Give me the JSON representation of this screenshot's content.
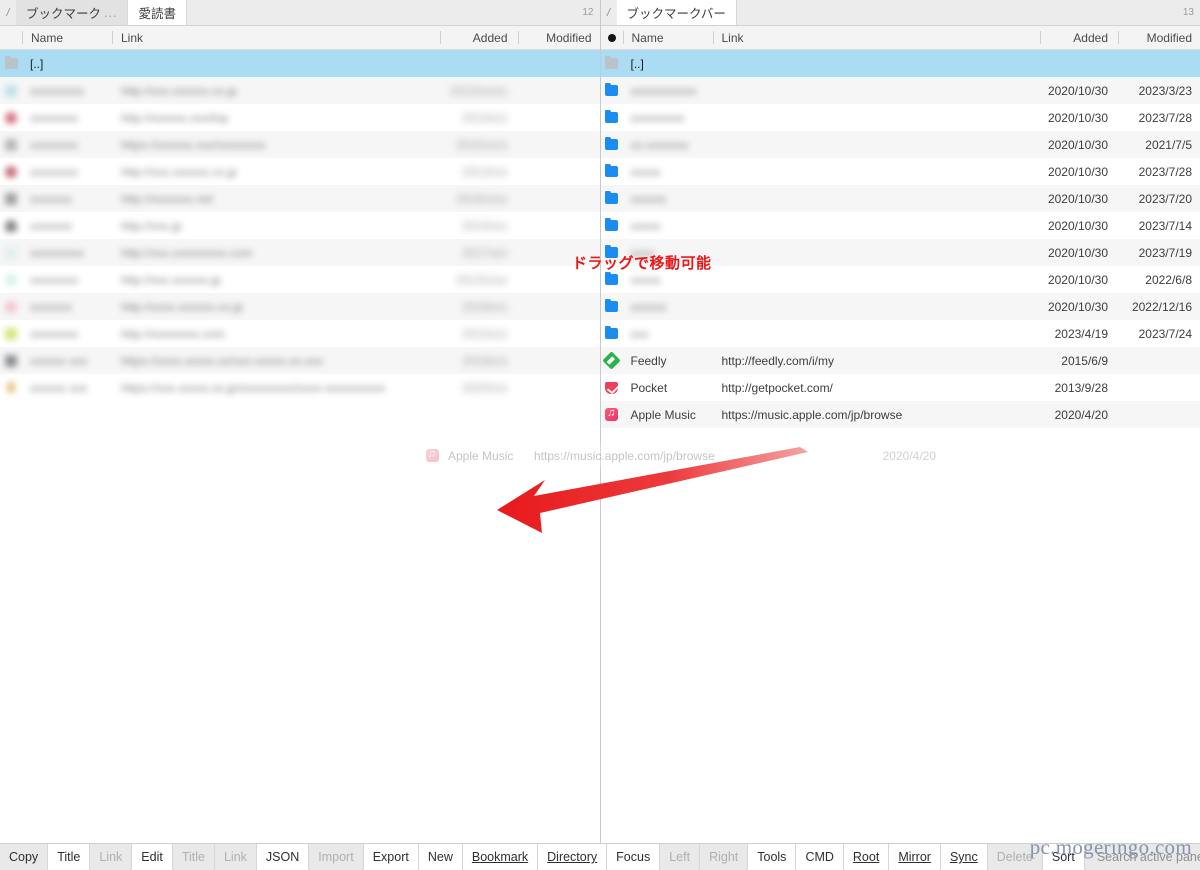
{
  "left_pane": {
    "tab_prefix": "/",
    "tabs": [
      {
        "label": "ブックマーク",
        "ellipsis": "...",
        "active": false
      },
      {
        "label": "愛読書",
        "ellipsis": "",
        "active": true
      }
    ],
    "count": "12",
    "columns": {
      "name": "Name",
      "link": "Link",
      "added": "Added",
      "modified": "Modified"
    },
    "rows": [
      {
        "icon": "folder-up-icon",
        "name": "[..]",
        "link": "",
        "added": "",
        "modified": "",
        "selected": true,
        "masked": false
      },
      {
        "icon": "favicon",
        "color": "#9fd4e0",
        "name": "xxxxxxxxx",
        "link": "http://xxx.xxxxxx.co.jp",
        "added": "2013/xx/xx",
        "modified": "",
        "masked": true
      },
      {
        "icon": "favicon",
        "color": "#bb2233",
        "name": "xxxxxxxx",
        "link": "http://xxxxxx.xxx/top",
        "added": "2014/x/x",
        "modified": "",
        "masked": true
      },
      {
        "icon": "favicon",
        "color": "#8b9096",
        "name": "xxxxxxxx",
        "link": "https://xxxxxx.xxx/xxxxxxxx",
        "added": "2015/xx/x",
        "modified": "",
        "masked": true
      },
      {
        "icon": "favicon",
        "color": "#a31a2a",
        "name": "xxxxxxxx",
        "link": "http://xxx.xxxxxx.co.jp",
        "added": "2013/x/x",
        "modified": "",
        "masked": true
      },
      {
        "icon": "favicon",
        "color": "#6c6c6c",
        "name": "xxxxxxx",
        "link": "http://xxxxxxx.net",
        "added": "2016/x/xx",
        "modified": "",
        "masked": true
      },
      {
        "icon": "favicon",
        "color": "#3f3f3f",
        "name": "xxxxxxx",
        "link": "http://xxx.jp",
        "added": "2014/x/x",
        "modified": "",
        "masked": true
      },
      {
        "icon": "favicon",
        "color": "#cfece9",
        "name": "xxxxxxxxx",
        "link": "http://xxx.xxxxxxxxx.com",
        "added": "2017/x/x",
        "modified": "",
        "masked": true
      },
      {
        "icon": "favicon",
        "color": "#bfe8db",
        "name": "xxxxxxxx",
        "link": "http://xxx.xxxxxx.jp",
        "added": "2013/x/xx",
        "modified": "",
        "masked": true
      },
      {
        "icon": "favicon",
        "color": "#f4a6b4",
        "name": "xxxxxxx",
        "link": "http://xxxx.xxxxxx.co.jp",
        "added": "2018/x/x",
        "modified": "",
        "masked": true
      },
      {
        "icon": "favicon",
        "color": "#b8d630",
        "name": "xxxxxxxx",
        "link": "http://xxxxxxxx.com",
        "added": "2015/x/x",
        "modified": "",
        "masked": true
      },
      {
        "icon": "favicon",
        "color": "#4b4f55",
        "name": "xxxxxx xxx",
        "link": "https://xxxx.xxxxx.xx/xxx-xxxxx-xx-xxx",
        "added": "2019/x/x",
        "modified": "",
        "masked": true
      },
      {
        "icon": "favicon",
        "color": "#d6a23a",
        "name": "xxxxxx xxx",
        "link": "https://xxx.xxxxx.xx.jp/xxxxxxxxx/xxxx-xxxxxxxxxx",
        "added": "2020/x/x",
        "modified": "",
        "masked": true
      }
    ]
  },
  "right_pane": {
    "tab_prefix": "/",
    "tabs": [
      {
        "label": "ブックマークバー",
        "ellipsis": "",
        "active": true
      }
    ],
    "count": "13",
    "header_dot": "sort-marker-dot",
    "columns": {
      "name": "Name",
      "link": "Link",
      "added": "Added",
      "modified": "Modified"
    },
    "rows": [
      {
        "icon": "folder-up-icon",
        "name": "[..]",
        "link": "",
        "added": "",
        "modified": "",
        "selected": true,
        "masked": false
      },
      {
        "icon": "folder-icon",
        "name": "xxxxxxxxxxx",
        "link": "",
        "added": "2020/10/30",
        "modified": "2023/3/23",
        "masked": true
      },
      {
        "icon": "folder-icon",
        "name": "xxxxxxxxx",
        "link": "",
        "added": "2020/10/30",
        "modified": "2023/7/28",
        "masked": true
      },
      {
        "icon": "folder-icon",
        "name": "xx-xxxxxxx",
        "link": "",
        "added": "2020/10/30",
        "modified": "2021/7/5",
        "masked": true
      },
      {
        "icon": "folder-icon",
        "name": "xxxxx",
        "link": "",
        "added": "2020/10/30",
        "modified": "2023/7/28",
        "masked": true
      },
      {
        "icon": "folder-icon",
        "name": "xxxxxx",
        "link": "",
        "added": "2020/10/30",
        "modified": "2023/7/20",
        "masked": true
      },
      {
        "icon": "folder-icon",
        "name": "xxxxx",
        "link": "",
        "added": "2020/10/30",
        "modified": "2023/7/14",
        "masked": true
      },
      {
        "icon": "folder-icon",
        "name": "xxxx",
        "link": "",
        "added": "2020/10/30",
        "modified": "2023/7/19",
        "masked": true
      },
      {
        "icon": "folder-icon",
        "name": "xxxxx",
        "link": "",
        "added": "2020/10/30",
        "modified": "2022/6/8",
        "masked": true
      },
      {
        "icon": "folder-icon",
        "name": "xxxxxx",
        "link": "",
        "added": "2020/10/30",
        "modified": "2022/12/16",
        "masked": true
      },
      {
        "icon": "folder-icon",
        "name": "xxx",
        "link": "",
        "added": "2023/4/19",
        "modified": "2023/7/24",
        "masked": true
      },
      {
        "icon": "feedly-icon",
        "name": "Feedly",
        "link": "http://feedly.com/i/my",
        "added": "2015/6/9",
        "modified": "",
        "masked": false
      },
      {
        "icon": "pocket-icon",
        "name": "Pocket",
        "link": "http://getpocket.com/",
        "added": "2013/9/28",
        "modified": "",
        "masked": false
      },
      {
        "icon": "apple-music-icon",
        "name": "Apple Music",
        "link": "https://music.apple.com/jp/browse",
        "added": "2020/4/20",
        "modified": "",
        "masked": false
      }
    ]
  },
  "drag_ghost": {
    "icon": "apple-music-icon",
    "name": "Apple Music",
    "link": "https://music.apple.com/jp/browse",
    "added": "2020/4/20"
  },
  "annotation": {
    "text": "ドラッグで移動可能",
    "arrow_color": "#e8191b"
  },
  "toolbar": {
    "buttons": [
      {
        "label": "Copy",
        "state": "enabled",
        "underline_index": -1
      },
      {
        "label": "Title",
        "state": "highlight",
        "underline_index": -1
      },
      {
        "label": "Link",
        "state": "disabled",
        "underline_index": -1
      },
      {
        "label": "Edit",
        "state": "enabled",
        "underline_index": -1
      },
      {
        "label": "Title",
        "state": "disabled",
        "underline_index": 3
      },
      {
        "label": "Link",
        "state": "disabled",
        "underline_index": -1
      },
      {
        "label": "JSON",
        "state": "highlight",
        "underline_index": -1
      },
      {
        "label": "Import",
        "state": "disabled",
        "underline_index": -1
      },
      {
        "label": "Export",
        "state": "highlight",
        "underline_index": -1
      },
      {
        "label": "New",
        "state": "enabled",
        "underline_index": -1
      },
      {
        "label": "Bookmark",
        "state": "highlight",
        "underline_index": 0
      },
      {
        "label": "Directory",
        "state": "highlight",
        "underline_index": 0
      },
      {
        "label": "Focus",
        "state": "enabled",
        "underline_index": -1
      },
      {
        "label": "Left",
        "state": "disabled",
        "underline_index": -1
      },
      {
        "label": "Right",
        "state": "disabled",
        "underline_index": -1
      },
      {
        "label": "Tools",
        "state": "enabled",
        "underline_index": -1
      },
      {
        "label": "CMD",
        "state": "highlight",
        "underline_index": -1
      },
      {
        "label": "Root",
        "state": "highlight",
        "underline_index": 1
      },
      {
        "label": "Mirror",
        "state": "highlight",
        "underline_index": 0
      },
      {
        "label": "Sync",
        "state": "highlight",
        "underline_index": 0
      },
      {
        "label": "Delete",
        "state": "disabled",
        "underline_index": -1
      },
      {
        "label": "Sort",
        "state": "enabled",
        "underline_index": -1
      }
    ],
    "search_placeholder": "Search active pane"
  },
  "watermark": {
    "text": "pc.mogeringo.com",
    "color": "#8794ad"
  }
}
